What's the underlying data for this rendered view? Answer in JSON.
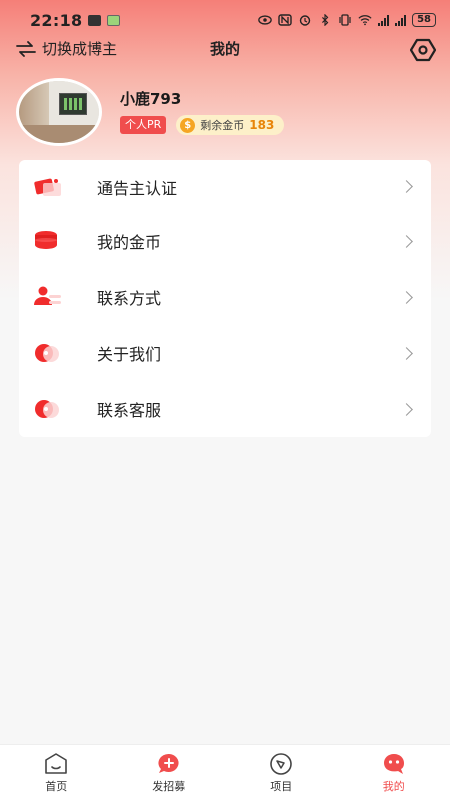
{
  "status_bar": {
    "time": "22:18",
    "battery": "58"
  },
  "header": {
    "switch_label": "切换成博主",
    "title": "我的"
  },
  "profile": {
    "username": "小鹿793",
    "role_badge": "个人PR",
    "coin_label": "剩余金币",
    "coin_count": "183",
    "coin_symbol": "$"
  },
  "menu": {
    "items": [
      {
        "label": "通告主认证",
        "icon": "certification-icon"
      },
      {
        "label": "我的金币",
        "icon": "coins-icon"
      },
      {
        "label": "联系方式",
        "icon": "contact-icon"
      },
      {
        "label": "关于我们",
        "icon": "about-icon"
      },
      {
        "label": "联系客服",
        "icon": "service-icon"
      }
    ]
  },
  "bottom_nav": {
    "items": [
      {
        "label": "首页",
        "icon": "home-icon",
        "active": false
      },
      {
        "label": "发招募",
        "icon": "post-recruit-icon",
        "active": false
      },
      {
        "label": "项目",
        "icon": "project-icon",
        "active": false
      },
      {
        "label": "我的",
        "icon": "profile-icon",
        "active": true
      }
    ]
  },
  "colors": {
    "accent": "#f04d4d",
    "coin": "#f5a623",
    "header_gradient_top": "#f57f78"
  }
}
